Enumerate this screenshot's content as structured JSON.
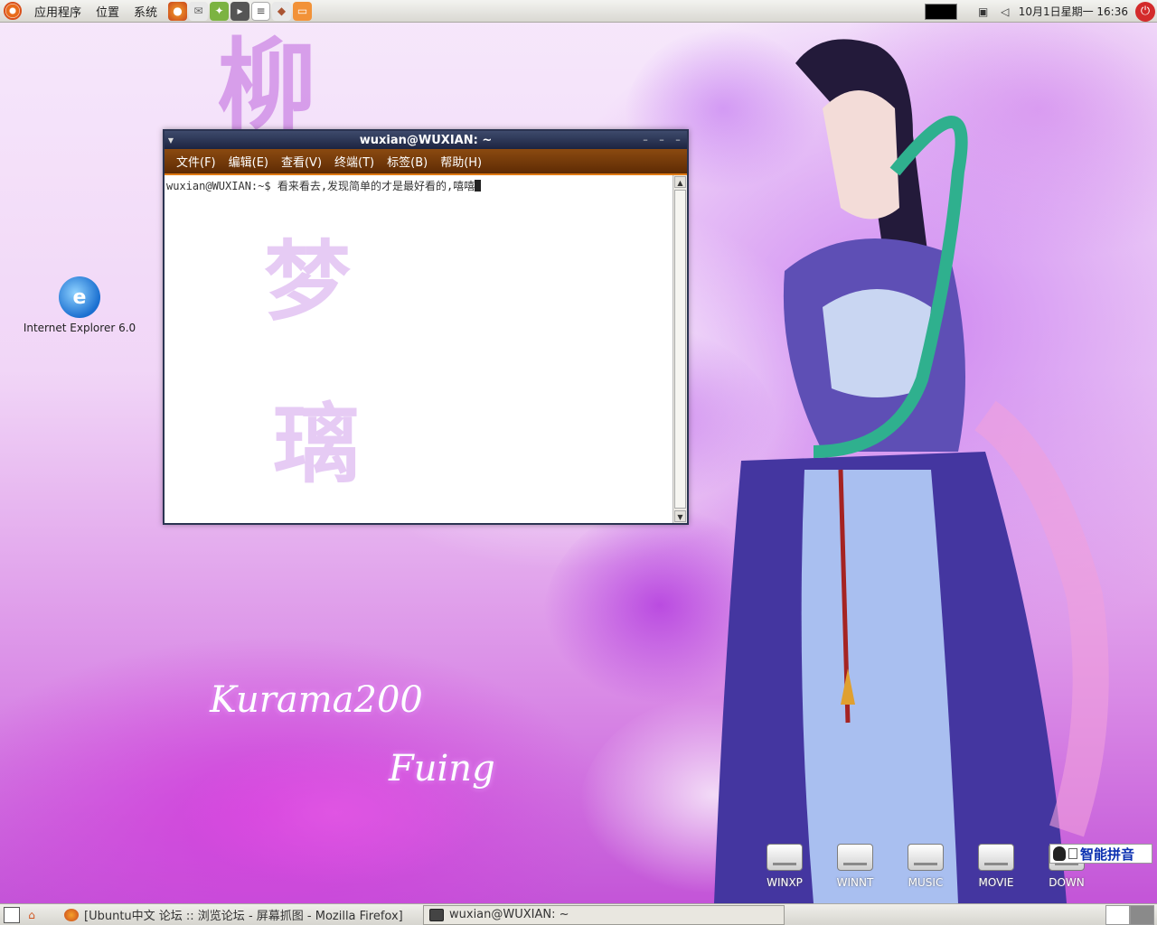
{
  "top_panel": {
    "menus": [
      "应用程序",
      "位置",
      "系统"
    ],
    "clock": "10月1日星期一 16:36"
  },
  "desktop": {
    "icons": [
      {
        "label": "Internet Explorer 6.0"
      }
    ],
    "drives": [
      "WINXP",
      "WINNT",
      "MUSIC",
      "MOVIE",
      "DOWN"
    ],
    "ime_label": "智能拼音"
  },
  "terminal": {
    "title": "wuxian@WUXIAN: ~",
    "menus": [
      "文件(F)",
      "编辑(E)",
      "查看(V)",
      "终端(T)",
      "标签(B)",
      "帮助(H)"
    ],
    "prompt": "wuxian@WUXIAN:~$ ",
    "command": "看来看去,发现简单的才是最好看的,嘻嘻"
  },
  "taskbar": {
    "firefox_task": "[Ubuntu中文 论坛 :: 浏览论坛 - 屏幕抓图 - Mozilla Firefox]",
    "terminal_task": "wuxian@WUXIAN: ~"
  },
  "colors": {
    "terminal_menubar": "#6e3508",
    "terminal_titlebar": "#2a3354",
    "ime_text": "#0a2fb0"
  }
}
